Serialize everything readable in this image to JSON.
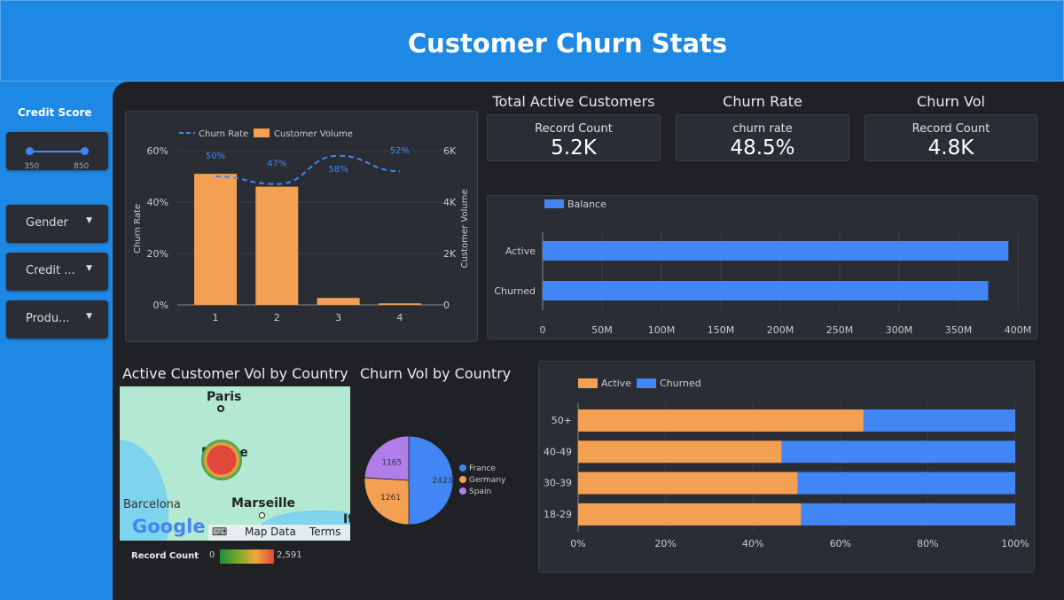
{
  "header": {
    "title": "Customer Churn Stats"
  },
  "sidebar": {
    "credit_score_label": "Credit Score",
    "slider": {
      "min": "350",
      "max": "850",
      "low": 350,
      "high": 850
    },
    "filters": [
      {
        "label": "Gender"
      },
      {
        "label": "Credit ..."
      },
      {
        "label": "Produ..."
      }
    ]
  },
  "kpis": [
    {
      "title": "Total Active Customers",
      "label": "Record Count",
      "value": "5.2K"
    },
    {
      "title": "Churn Rate",
      "label": "churn rate",
      "value": "48.5%"
    },
    {
      "title": "Churn Vol",
      "label": "Record Count",
      "value": "4.8K"
    }
  ],
  "colors": {
    "orange": "#f4a053",
    "blue": "#4285f4",
    "purple": "#b07ee8",
    "header": "#1e88e5"
  },
  "map": {
    "title": "Active Customer Vol by Country",
    "labels": {
      "paris": "Paris",
      "france": "France",
      "marseille": "Marseille",
      "barcelona": "Barcelona",
      "italy": "It"
    },
    "logo": "Google",
    "map_data": "Map Data",
    "terms": "Terms",
    "legend_label": "Record Count",
    "legend_min": "0",
    "legend_max": "2,591"
  },
  "chart_data": [
    {
      "type": "bar+line",
      "categories": [
        "1",
        "2",
        "3",
        "4"
      ],
      "series": [
        {
          "name": "Customer Volume",
          "axis": "right",
          "values": [
            5100,
            4600,
            270,
            60
          ]
        },
        {
          "name": "Churn Rate",
          "axis": "left",
          "values": [
            50,
            47,
            58,
            52
          ],
          "labels": [
            "50%",
            "47%",
            "58%",
            "52%"
          ]
        }
      ],
      "ylabel": "Churn Rate",
      "y2label": "Customer Volume",
      "ylim": [
        0,
        60
      ],
      "y2lim": [
        0,
        6000
      ],
      "yticks": [
        "0%",
        "20%",
        "40%",
        "60%"
      ],
      "y2ticks": [
        "0",
        "2K",
        "4K",
        "6K"
      ],
      "legend": "top"
    },
    {
      "type": "bar",
      "orientation": "horizontal",
      "categories": [
        "Active",
        "Churned"
      ],
      "series": [
        {
          "name": "Balance",
          "values": [
            392000000,
            375000000
          ]
        }
      ],
      "xlim": [
        0,
        400000000
      ],
      "xticks": [
        "0",
        "50M",
        "100M",
        "150M",
        "200M",
        "250M",
        "300M",
        "350M",
        "400M"
      ],
      "legend": "top-left"
    },
    {
      "type": "pie",
      "title": "Churn Vol by Country",
      "categories": [
        "France",
        "Germany",
        "Spain"
      ],
      "values": [
        2423,
        1261,
        1165
      ],
      "labels": [
        "2423",
        "1261",
        "1165"
      ],
      "legend": "right"
    },
    {
      "type": "bar",
      "orientation": "horizontal",
      "stacked": "percent",
      "categories": [
        "50+",
        "40-49",
        "30-39",
        "18-29"
      ],
      "series": [
        {
          "name": "Active",
          "values": [
            65.3,
            46.6,
            50.2,
            51.0
          ]
        },
        {
          "name": "Churned",
          "values": [
            34.7,
            53.4,
            49.8,
            49.0
          ]
        }
      ],
      "xlim": [
        0,
        100
      ],
      "xticks": [
        "0%",
        "20%",
        "40%",
        "60%",
        "80%",
        "100%"
      ],
      "legend": "top-left"
    }
  ]
}
